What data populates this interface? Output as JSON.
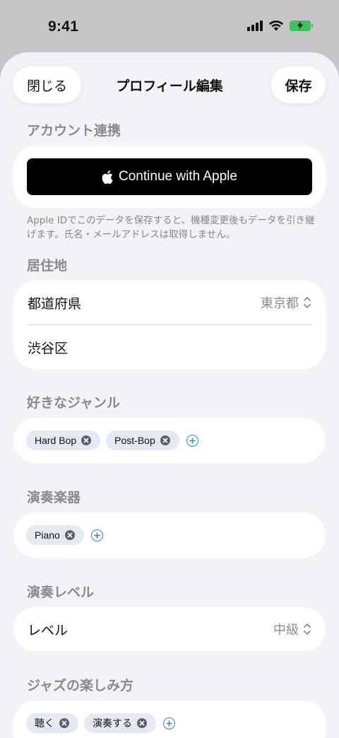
{
  "status_bar": {
    "time": "9:41"
  },
  "header": {
    "close_label": "閉じる",
    "title": "プロフィール編集",
    "save_label": "保存"
  },
  "account": {
    "section_label": "アカウント連携",
    "apple_button_label": "Continue with Apple",
    "footnote": "Apple IDでこのデータを保存すると、機種変更後もデータを引き継げます。氏名・メールアドレスは取得しません。"
  },
  "residence": {
    "section_label": "居住地",
    "prefecture_label": "都道府県",
    "prefecture_value": "東京都",
    "city_value": "渋谷区"
  },
  "genres": {
    "section_label": "好きなジャンル",
    "chips": [
      "Hard Bop",
      "Post-Bop"
    ]
  },
  "instruments": {
    "section_label": "演奏楽器",
    "chips": [
      "Piano"
    ]
  },
  "level": {
    "section_label": "演奏レベル",
    "label": "レベル",
    "value": "中級"
  },
  "enjoy": {
    "section_label": "ジャズの楽しみ方",
    "chips": [
      "聴く",
      "演奏する"
    ]
  },
  "colors": {
    "background": "#f2f2f7",
    "card": "#ffffff",
    "accent": "#1a8fd6",
    "chip_bg": "#e3eaf3",
    "battery": "#34c759"
  }
}
